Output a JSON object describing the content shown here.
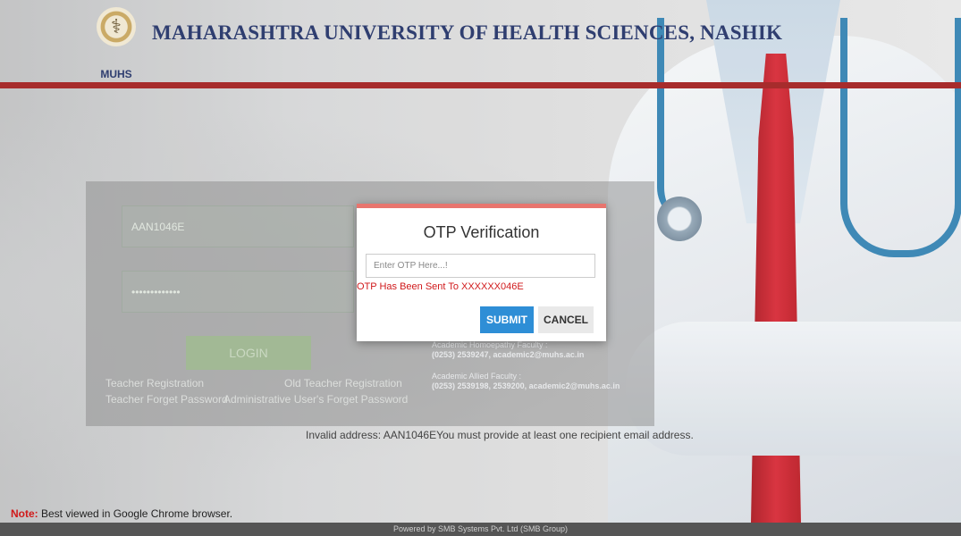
{
  "header": {
    "logo_text": "MUHS",
    "title": "MAHARASHTRA UNIVERSITY OF HEALTH SCIENCES, NASHIK"
  },
  "login": {
    "username_value": "AAN1046E",
    "password_value": "•••••••••••••",
    "login_label": "LOGIN",
    "links": {
      "teacher_registration": "Teacher Registration",
      "old_teacher_registration": "Old Teacher Registration",
      "teacher_forget_password": "Teacher Forget Password",
      "admin_forget_password": "Administrative User's Forget Password"
    },
    "contacts": [
      {
        "label": "Academic Homoepathy Faculty :",
        "detail": "(0253) 2539247, academic2@muhs.ac.in"
      },
      {
        "label": "Academic Allied Faculty :",
        "detail": "(0253) 2539198, 2539200, academic2@muhs.ac.in"
      }
    ]
  },
  "error_message": "Invalid address: AAN1046EYou must provide at least one recipient email address.",
  "modal": {
    "title": "OTP Verification",
    "otp_placeholder": "Enter OTP Here...!",
    "otp_value": "",
    "message": "OTP Has Been Sent To XXXXXX046E",
    "submit_label": "SUBMIT",
    "cancel_label": "CANCEL"
  },
  "note": {
    "prefix": "Note:",
    "text": " Best viewed in Google Chrome browser."
  },
  "footer": {
    "text": "Powered by SMB Systems Pvt. Ltd (SMB Group)"
  },
  "colors": {
    "header_bar": "#a01b1b",
    "modal_accent": "#e8756e",
    "submit_button": "#2e8ed6",
    "error_text": "#d0191b",
    "title_text": "#1e2e64"
  }
}
